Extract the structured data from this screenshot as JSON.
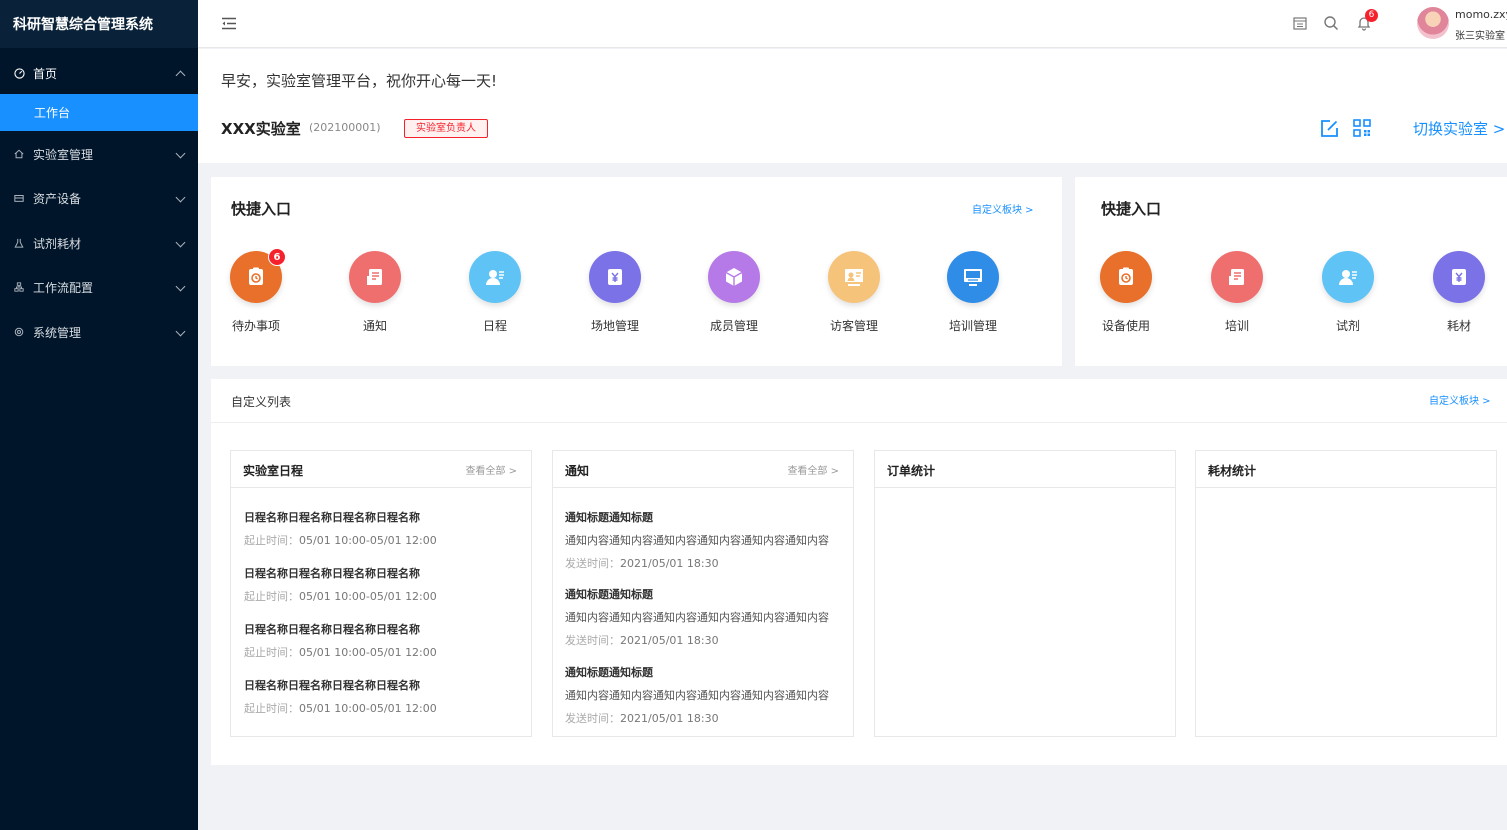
{
  "app": {
    "title": "科研智慧综合管理系统"
  },
  "sidebar": {
    "home": {
      "label": "首页"
    },
    "workbench": {
      "label": "工作台"
    },
    "items": [
      {
        "label": "实验室管理",
        "icon": "home-icon"
      },
      {
        "label": "资产设备",
        "icon": "box-icon"
      },
      {
        "label": "试剂耗材",
        "icon": "flask-icon"
      },
      {
        "label": "工作流配置",
        "icon": "workflow-icon"
      },
      {
        "label": "系统管理",
        "icon": "gear-icon"
      }
    ]
  },
  "topbar": {
    "notification_count": "6",
    "user_name": "momo.zxy",
    "user_lab": "张三实验室"
  },
  "header": {
    "greeting": "早安，实验室管理平台，祝你开心每一天!",
    "lab_name": "XXX实验室",
    "lab_code": "(202100001)",
    "role": "实验室负责人",
    "switch_label": "切换实验室 >"
  },
  "quick_entry_main": {
    "title": "快捷入口",
    "customize": "自定义板块 >",
    "items": [
      {
        "label": "待办事项",
        "color": "#e8702a",
        "badge": "6"
      },
      {
        "label": "通知",
        "color": "#ef6f6f"
      },
      {
        "label": "日程",
        "color": "#5fc3f5"
      },
      {
        "label": "场地管理",
        "color": "#7a72e6"
      },
      {
        "label": "成员管理",
        "color": "#b67ae8"
      },
      {
        "label": "访客管理",
        "color": "#f6c37a"
      },
      {
        "label": "培训管理",
        "color": "#2f8de8"
      }
    ]
  },
  "quick_entry_side": {
    "title": "快捷入口",
    "items": [
      {
        "label": "设备使用",
        "color": "#e8702a"
      },
      {
        "label": "培训",
        "color": "#ef6f6f"
      },
      {
        "label": "试剂",
        "color": "#5fc3f5"
      },
      {
        "label": "耗材",
        "color": "#7a72e6"
      }
    ]
  },
  "custom_list": {
    "title": "自定义列表",
    "customize": "自定义板块 >",
    "schedule": {
      "title": "实验室日程",
      "more": "查看全部 >",
      "items": [
        {
          "name": "日程名称日程名称日程名称日程名称",
          "time_label": "起止时间：",
          "time": "05/01 10:00-05/01 12:00"
        },
        {
          "name": "日程名称日程名称日程名称日程名称",
          "time_label": "起止时间：",
          "time": "05/01 10:00-05/01 12:00"
        },
        {
          "name": "日程名称日程名称日程名称日程名称",
          "time_label": "起止时间：",
          "time": "05/01 10:00-05/01 12:00"
        },
        {
          "name": "日程名称日程名称日程名称日程名称",
          "time_label": "起止时间：",
          "time": "05/01 10:00-05/01 12:00"
        }
      ]
    },
    "notice": {
      "title": "通知",
      "more": "查看全部 >",
      "items": [
        {
          "title": "通知标题通知标题",
          "content": "通知内容通知内容通知内容通知内容通知内容通知内容",
          "time_label": "发送时间：",
          "time": "2021/05/01 18:30"
        },
        {
          "title": "通知标题通知标题",
          "content": "通知内容通知内容通知内容通知内容通知内容通知内容",
          "time_label": "发送时间：",
          "time": "2021/05/01 18:30"
        },
        {
          "title": "通知标题通知标题",
          "content": "通知内容通知内容通知内容通知内容通知内容通知内容",
          "time_label": "发送时间：",
          "time": "2021/05/01 18:30"
        }
      ]
    },
    "orders": {
      "title": "订单统计"
    },
    "consumables": {
      "title": "耗材统计"
    }
  }
}
